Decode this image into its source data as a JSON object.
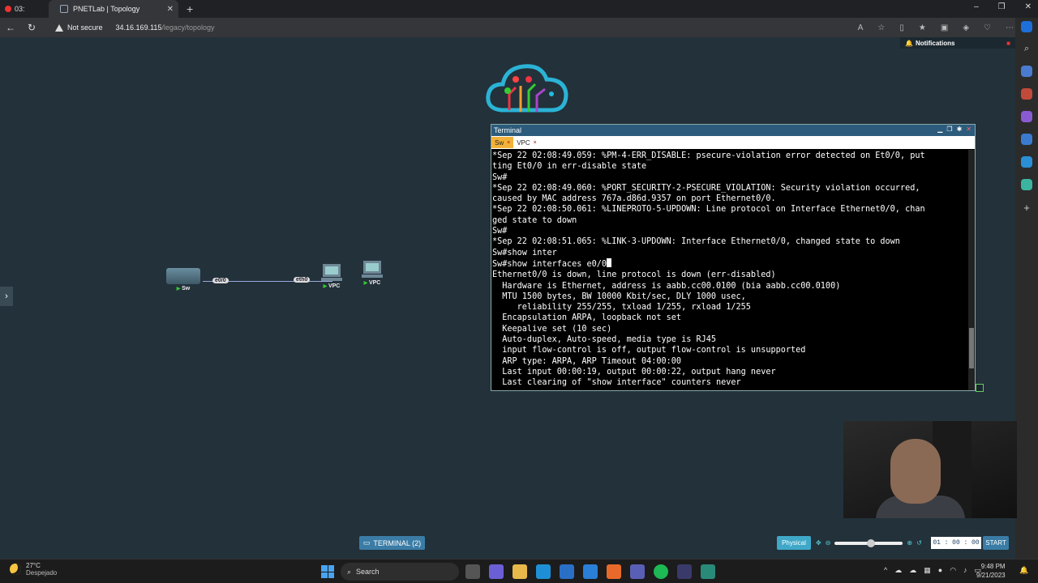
{
  "browser": {
    "rec_time": "03:",
    "tab_title": "PNETLab | Topology",
    "new_tab": "+",
    "security_label": "Not secure",
    "url_host": "34.16.169.115",
    "url_path": "/legacy/topology",
    "window_min": "–",
    "window_max": "❐",
    "window_close": "✕"
  },
  "page": {
    "notifications_label": "Notifications",
    "sidebar_toggle": "›"
  },
  "topology": {
    "switch_label": "Sw",
    "switch_port": "e0/0",
    "vpc1_port": "eth0",
    "vpc1_label": "VPC",
    "vpc2_label": "VPC"
  },
  "terminal": {
    "title": "Terminal",
    "tabs": [
      {
        "label": "Sw",
        "close": "×"
      },
      {
        "label": "VPC",
        "close": "×"
      }
    ],
    "lines": [
      "*Sep 22 02:08:49.059: %PM-4-ERR_DISABLE: psecure-violation error detected on Et0/0, put",
      "ting Et0/0 in err-disable state",
      "Sw#",
      "*Sep 22 02:08:49.060: %PORT_SECURITY-2-PSECURE_VIOLATION: Security violation occurred,",
      "caused by MAC address 767a.d86d.9357 on port Ethernet0/0.",
      "*Sep 22 02:08:50.061: %LINEPROTO-5-UPDOWN: Line protocol on Interface Ethernet0/0, chan",
      "ged state to down",
      "Sw#",
      "*Sep 22 02:08:51.065: %LINK-3-UPDOWN: Interface Ethernet0/0, changed state to down",
      "Sw#show inter",
      "Sw#show interfaces e0/0",
      "Ethernet0/0 is down, line protocol is down (err-disabled)",
      "  Hardware is Ethernet, address is aabb.cc00.0100 (bia aabb.cc00.0100)",
      "  MTU 1500 bytes, BW 10000 Kbit/sec, DLY 1000 usec,",
      "     reliability 255/255, txload 1/255, rxload 1/255",
      "  Encapsulation ARPA, loopback not set",
      "  Keepalive set (10 sec)",
      "  Auto-duplex, Auto-speed, media type is RJ45",
      "  input flow-control is off, output flow-control is unsupported",
      "  ARP type: ARPA, ARP Timeout 04:00:00",
      "  Last input 00:00:19, output 00:00:22, output hang never",
      "  Last clearing of \"show interface\" counters never"
    ]
  },
  "controls": {
    "terminal_button": "TERMINAL (2)",
    "physical_button": "Physical",
    "timer": [
      "01",
      "00",
      "00"
    ],
    "start_button": "START"
  },
  "taskbar": {
    "temperature": "27°C",
    "weather": "Despejado",
    "search_label": "Search",
    "time": "9:48 PM",
    "date": "9/21/2023"
  },
  "colors": {
    "terminal_active_tab": "#f2b23a",
    "terminal_titlebar": "#2c5b7b",
    "page_background": "#23313a",
    "accent": "#3a7ca5"
  }
}
